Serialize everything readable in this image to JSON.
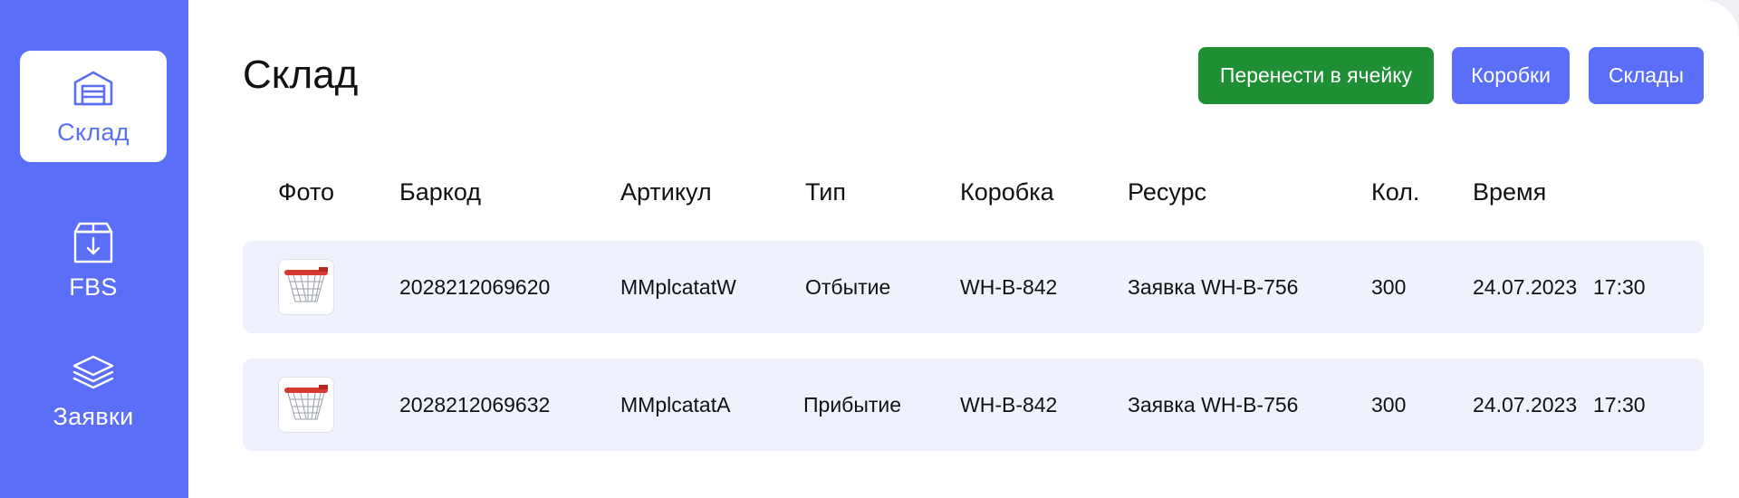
{
  "sidebar": {
    "items": [
      {
        "label": "Склад",
        "icon": "warehouse-icon",
        "active": true
      },
      {
        "label": "FBS",
        "icon": "box-download-icon",
        "active": false
      },
      {
        "label": "Заявки",
        "icon": "layers-icon",
        "active": false
      }
    ]
  },
  "header": {
    "title": "Склад",
    "buttons": {
      "move_to_cell": "Перенести в ячейку",
      "boxes": "Коробки",
      "warehouses": "Склады"
    }
  },
  "table": {
    "columns": [
      "Фото",
      "Баркод",
      "Артикул",
      "Тип",
      "Коробка",
      "Ресурс",
      "Кол.",
      "Время"
    ],
    "rows": [
      {
        "photo": "basketball-hoop-image",
        "barcode": "2028212069620",
        "article": "MMplcatatW",
        "type": "Отбытие",
        "box": "WH-B-842",
        "resource": "Заявка WH-B-756",
        "qty": "300",
        "date": "24.07.2023",
        "time": "17:30"
      },
      {
        "photo": "basketball-hoop-image",
        "barcode": "2028212069632",
        "article": "MMplcatatA",
        "type": "Прибытие",
        "box": "WH-B-842",
        "resource": "Заявка WH-B-756",
        "qty": "300",
        "date": "24.07.2023",
        "time": "17:30"
      }
    ]
  },
  "colors": {
    "accent": "#5a6ef7",
    "green": "#1f8f35",
    "row_bg": "#eff2fd"
  }
}
